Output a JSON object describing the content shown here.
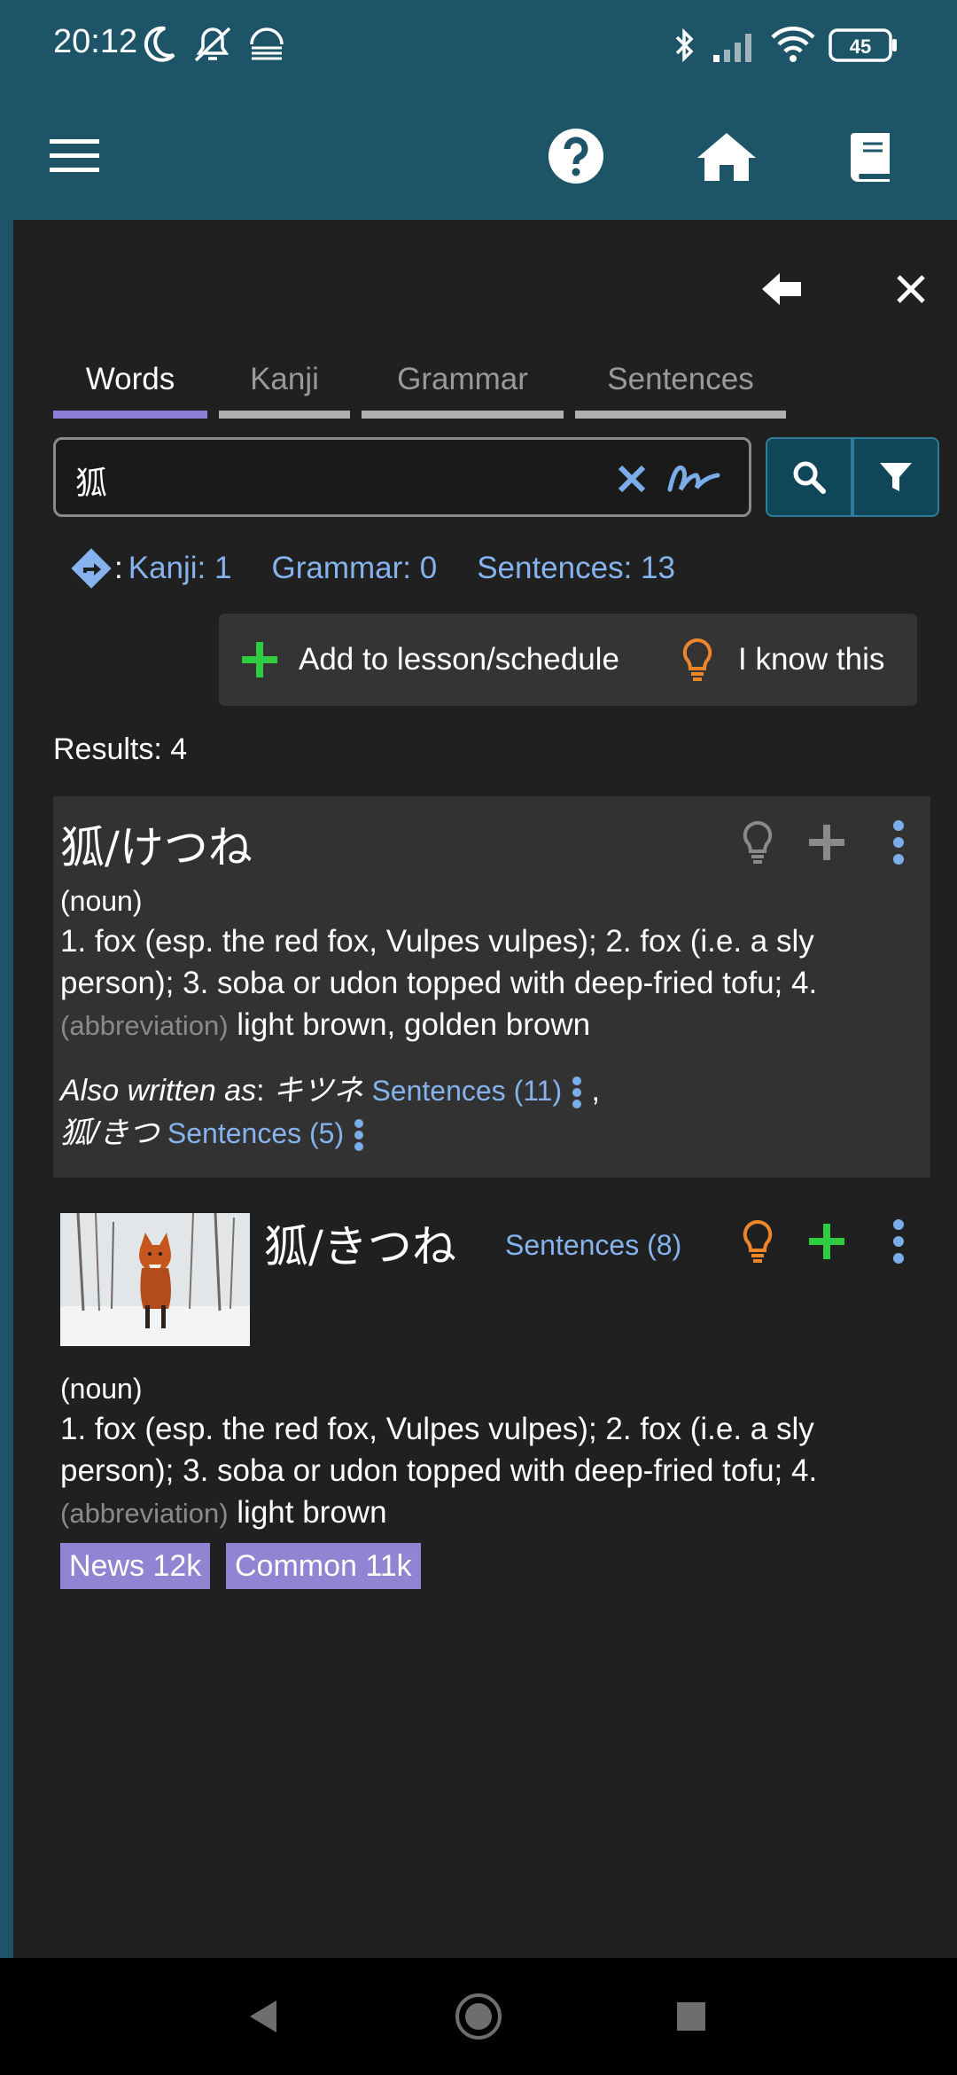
{
  "status": {
    "time": "20:12",
    "battery": "45"
  },
  "icons": {
    "menu": "hamburger-menu-icon",
    "help": "question-circle-icon",
    "home": "home-icon",
    "book": "book-icon",
    "back": "arrow-left-icon",
    "close": "close-icon"
  },
  "tabs": [
    {
      "label": "Words",
      "active": true
    },
    {
      "label": "Kanji",
      "active": false
    },
    {
      "label": "Grammar",
      "active": false
    },
    {
      "label": "Sentences",
      "active": false
    }
  ],
  "search": {
    "value": "狐"
  },
  "links": {
    "prefix": ":",
    "kanji": "Kanji: 1",
    "grammar": "Grammar: 0",
    "sentences": "Sentences: 13"
  },
  "actions": {
    "add": "Add to lesson/schedule",
    "know": "I know this"
  },
  "results": {
    "label": "Results: 4"
  },
  "entries": [
    {
      "title": "狐/けつね",
      "pos": "(noun)",
      "def_line1": "1. fox (esp. the red fox, Vulpes vulpes); 2. fox (i.e. a sly",
      "def_line2": "person); 3. soba or udon topped with deep-fried tofu; 4.",
      "def_abbr": "(abbreviation)",
      "def_end": " light brown, golden brown",
      "also_label": "Also written as",
      "also_colon": ": ",
      "alt1": "キツネ",
      "alt1_sentences": "Sentences (11)",
      "comma": " ,",
      "alt2": "狐/きつ",
      "alt2_sentences": "Sentences (5)"
    },
    {
      "title": "狐/きつね",
      "sentences": "Sentences (8)",
      "pos": "(noun)",
      "def_line1": "1. fox (esp. the red fox, Vulpes vulpes); 2. fox (i.e. a sly",
      "def_line2": "person); 3. soba or udon topped with deep-fried tofu; 4.",
      "def_abbr": "(abbreviation)",
      "def_end": " light brown",
      "tags": [
        "News 12k",
        "Common 11k"
      ]
    }
  ],
  "colors": {
    "header": "#1d5468",
    "panel": "#202020",
    "tab_active": "#8b7fd6",
    "link": "#86b3ee",
    "green": "#2ecc40",
    "orange": "#f0862a",
    "tag": "#8f85d2"
  }
}
